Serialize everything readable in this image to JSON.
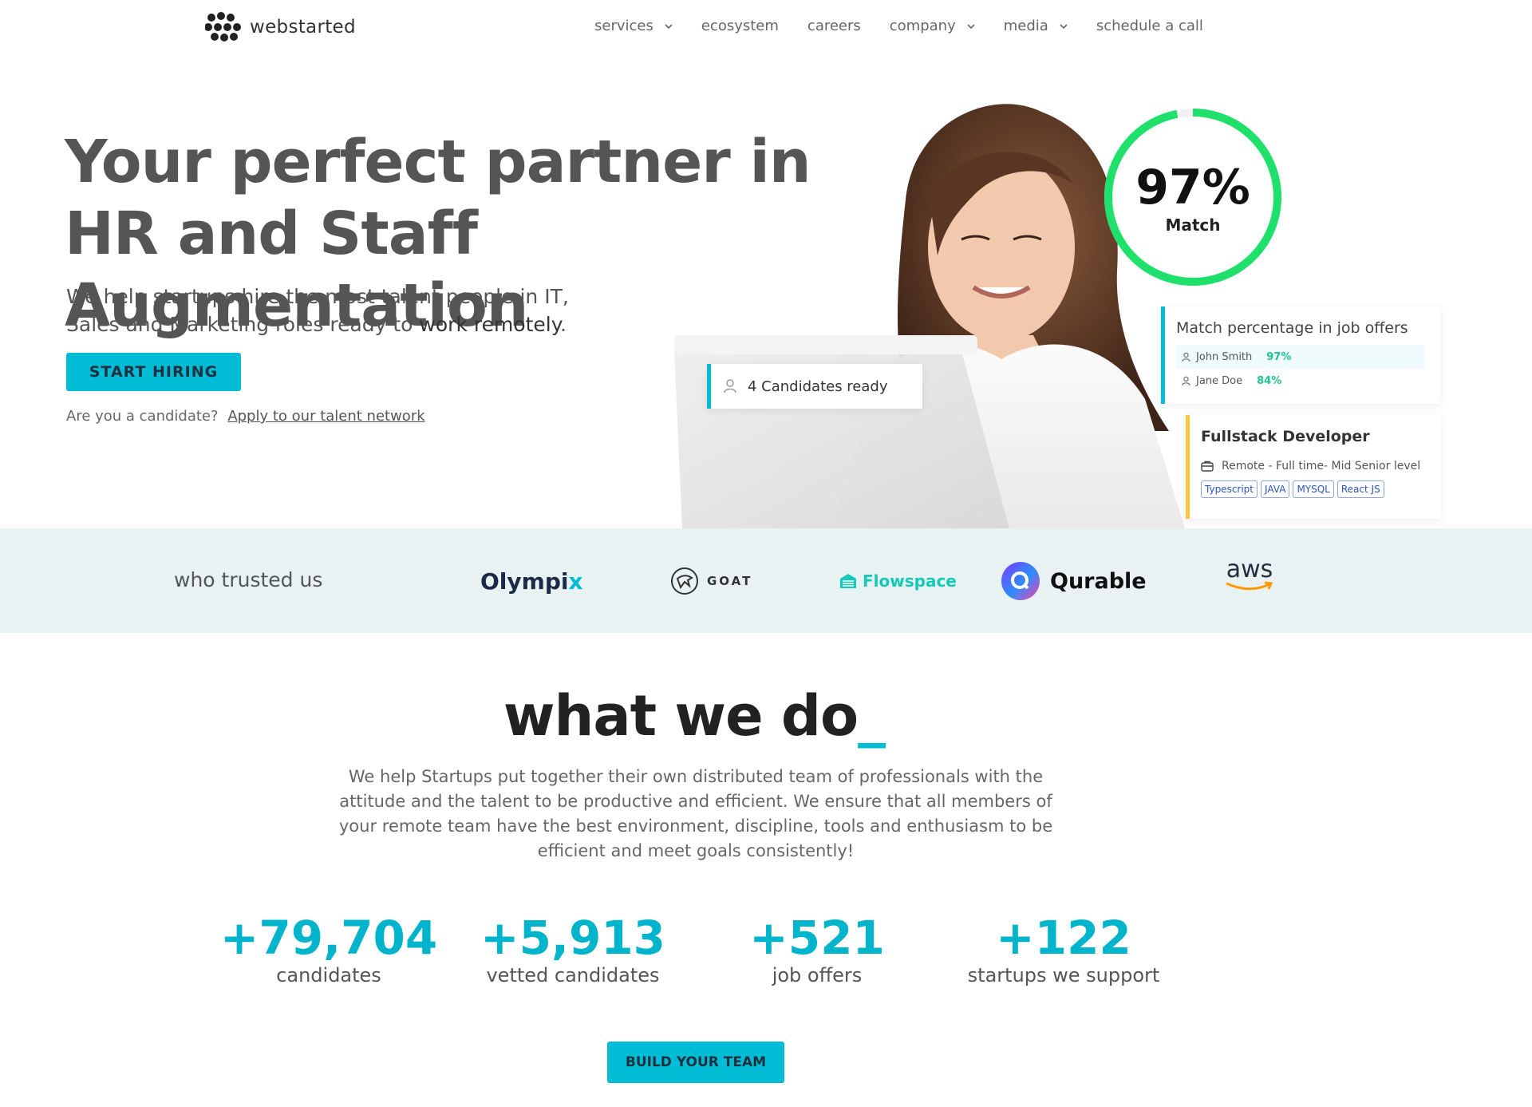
{
  "brand": {
    "name": "webstarted"
  },
  "nav": {
    "items": [
      {
        "label": "services",
        "dropdown": true
      },
      {
        "label": "ecosystem",
        "dropdown": false
      },
      {
        "label": "careers",
        "dropdown": false
      },
      {
        "label": "company",
        "dropdown": true
      },
      {
        "label": "media",
        "dropdown": true
      },
      {
        "label": "schedule a call",
        "dropdown": false
      }
    ]
  },
  "hero": {
    "title": "Your perfect partner in HR and Staff Augmentation",
    "subtitle_start": "We help startups hire the most talent people in IT, Sales and Marketing roles ready to ",
    "subtitle_emphasis": "work remotely",
    "subtitle_end": ".",
    "cta_label": "START HIRING",
    "candidate_question": "Are you a candidate?",
    "candidate_link": "Apply to our talent network"
  },
  "widgets": {
    "match_value": "97%",
    "match_label": "Match",
    "match_progress": 0.97,
    "candidates_ready": "4 Candidates ready",
    "match_card_title": "Match percentage in job offers",
    "match_rows": [
      {
        "name": "John Smith",
        "pct": "97%"
      },
      {
        "name": "Jane Doe",
        "pct": "84%"
      }
    ],
    "job_title": "Fullstack Developer",
    "job_meta": "Remote - Full time- Mid Senior level",
    "job_tags": [
      "Typescript",
      "JAVA",
      "MYSQL",
      "React JS"
    ]
  },
  "trusted": {
    "label": "who trusted us",
    "olympix_main": "Olympi",
    "olympix_x": "x",
    "goat": "GOAT",
    "flowspace": "Flowspace",
    "qurable": "Qurable",
    "aws": "aws"
  },
  "what_we_do": {
    "title": "what we do",
    "title_suffix": "_",
    "text": "We help Startups put together their own distributed team of professionals with the attitude and the talent to be productive and efficient. We ensure that all members of your remote team have the best environment, discipline, tools and enthusiasm to be efficient and meet goals consistently!",
    "stats": [
      {
        "value": "+79,704",
        "label": "candidates"
      },
      {
        "value": "+5,913",
        "label": "vetted candidates"
      },
      {
        "value": "+521",
        "label": "job offers"
      },
      {
        "value": "+122",
        "label": "startups we support"
      }
    ],
    "cta_label": "BUILD YOUR TEAM"
  },
  "colors": {
    "accent": "#00bcd4",
    "ring": "#1ee06a",
    "band": "#e8f2f3",
    "job_accent": "#ffc53d"
  }
}
